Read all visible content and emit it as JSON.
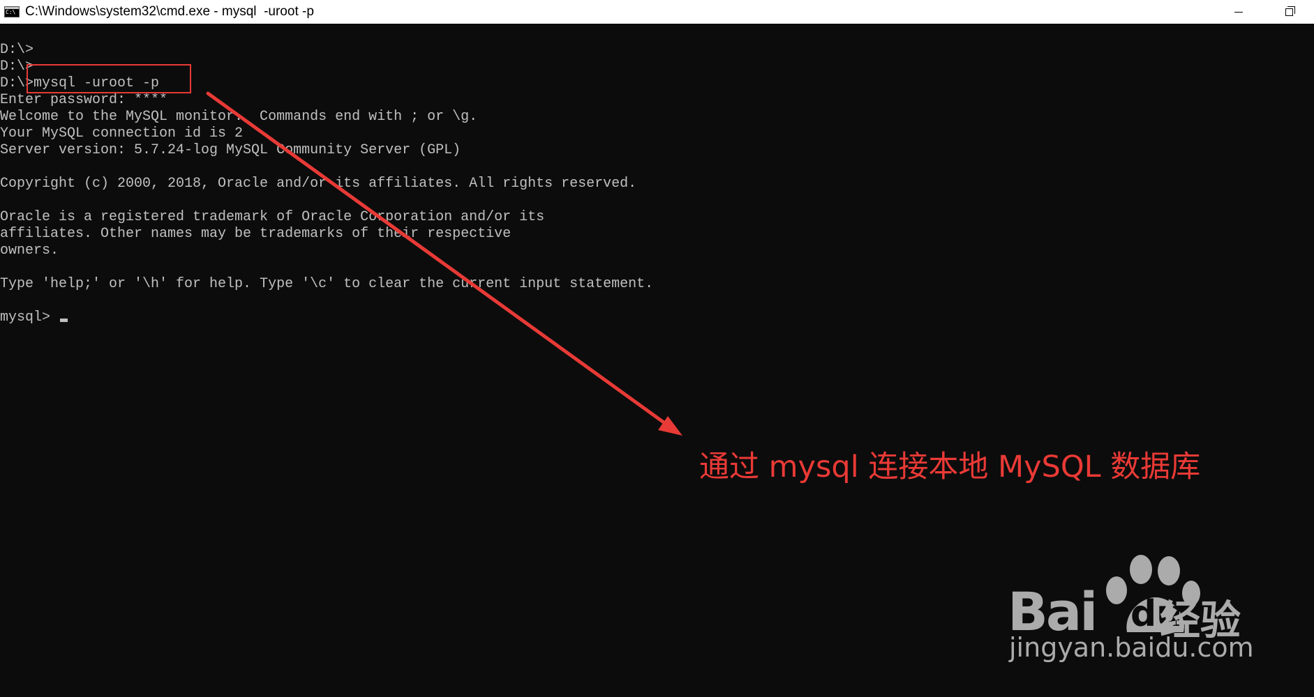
{
  "window": {
    "title": "C:\\Windows\\system32\\cmd.exe - mysql  -uroot -p"
  },
  "console": {
    "lines": [
      "D:\\>",
      "D:\\>",
      "D:\\>mysql -uroot -p",
      "Enter password: ****",
      "Welcome to the MySQL monitor.  Commands end with ; or \\g.",
      "Your MySQL connection id is 2",
      "Server version: 5.7.24-log MySQL Community Server (GPL)",
      "",
      "Copyright (c) 2000, 2018, Oracle and/or its affiliates. All rights reserved.",
      "",
      "Oracle is a registered trademark of Oracle Corporation and/or its",
      "affiliates. Other names may be trademarks of their respective",
      "owners.",
      "",
      "Type 'help;' or '\\h' for help. Type '\\c' to clear the current input statement.",
      "",
      "mysql> "
    ]
  },
  "annotation": {
    "text": "通过 mysql 连接本地 MySQL 数据库",
    "color": "#ea3a36"
  },
  "watermark": {
    "brand_bai": "Bai",
    "brand_du": "du",
    "brand_cn": "经验",
    "url": "jingyan.baidu.com"
  },
  "colors": {
    "console_bg": "#0c0c0c",
    "console_fg": "#c0c0c0",
    "highlight": "#e83a36"
  }
}
